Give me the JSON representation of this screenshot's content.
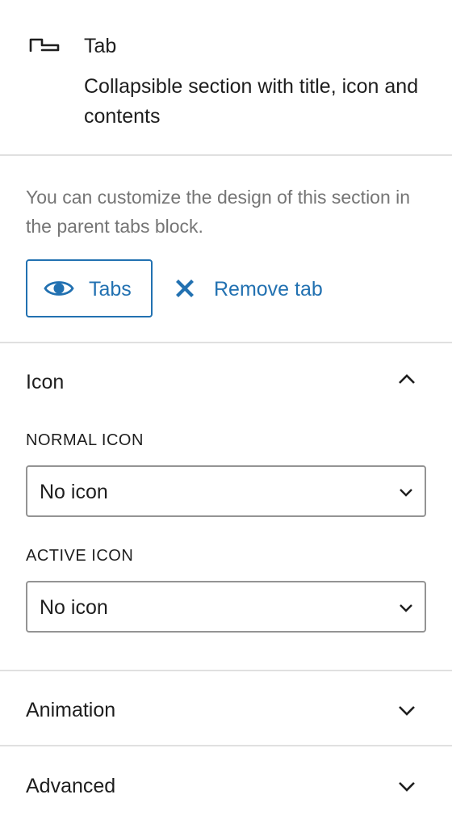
{
  "block": {
    "icon": "tab-icon",
    "title": "Tab",
    "description": "Collapsible section with title, icon and contents"
  },
  "notice": "You can customize the design of this section in the parent tabs block.",
  "actions": {
    "tabs_label": "Tabs",
    "tabs_icon": "eye-icon",
    "remove_label": "Remove tab",
    "remove_icon": "close-icon"
  },
  "icon_panel": {
    "title": "Icon",
    "expanded": true,
    "normal_icon": {
      "label": "NORMAL ICON",
      "value": "No icon"
    },
    "active_icon": {
      "label": "ACTIVE ICON",
      "value": "No icon"
    }
  },
  "animation_panel": {
    "title": "Animation",
    "expanded": false
  },
  "advanced_panel": {
    "title": "Advanced",
    "expanded": false
  },
  "colors": {
    "accent": "#2271b1",
    "text": "#1e1e1e",
    "muted": "#757575",
    "border": "#949494",
    "divider": "#e0e0e0"
  }
}
